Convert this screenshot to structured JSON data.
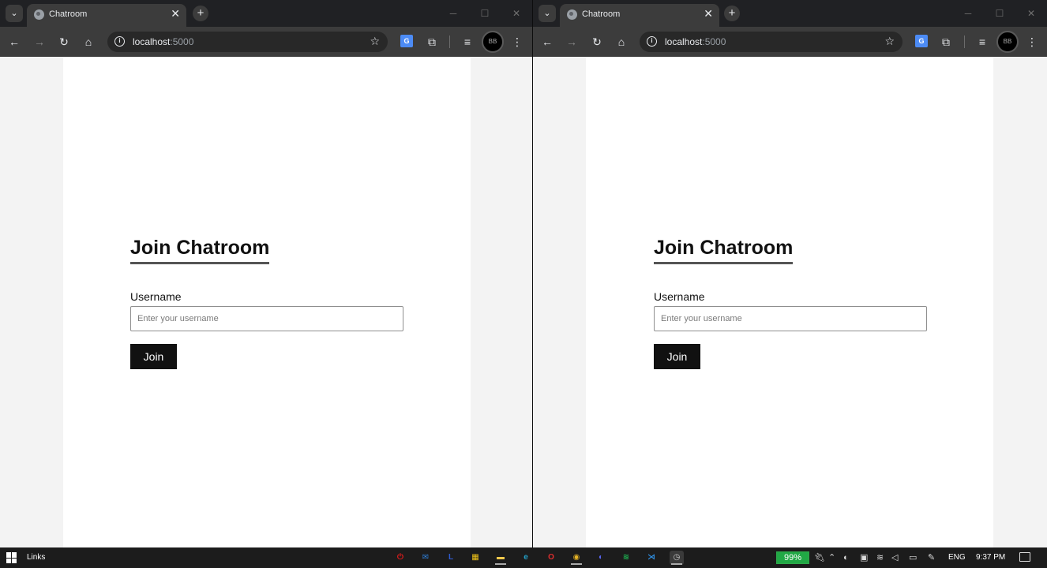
{
  "browser": {
    "tab_title": "Chatroom",
    "url_host": "localhost",
    "url_port": ":5000",
    "icons": [
      "tab-search-icon",
      "favicon-globe-icon",
      "close-icon",
      "new-tab-icon",
      "minimize-icon",
      "maximize-icon",
      "window-close-icon",
      "back-icon",
      "forward-icon",
      "reload-icon",
      "home-icon",
      "site-info-icon",
      "bookmark-star-icon",
      "translate-icon",
      "extensions-icon",
      "media-control-icon",
      "profile-avatar",
      "kebab-menu-icon"
    ]
  },
  "glyphs": {
    "tab_search": "⌄",
    "tab_close": "✕",
    "new_tab": "+",
    "minimize": "─",
    "maximize": "☐",
    "window_close": "✕",
    "back": "←",
    "forward": "→",
    "reload": "↻",
    "home": "⌂",
    "info": "i",
    "star": "☆",
    "translate": "G",
    "extensions": "⧉",
    "media": "≡",
    "profile": "BB",
    "menu": "⋮"
  },
  "app": {
    "heading": "Join Chatroom",
    "username_label": "Username",
    "username_placeholder": "Enter your username",
    "join_label": "Join"
  },
  "taskbar": {
    "links_label": "Links",
    "battery": "99%",
    "language": "ENG",
    "time": "9:37 PM",
    "apps": [
      {
        "name": "power-app-icon",
        "glyph": "⏻",
        "color": "#e21b1b"
      },
      {
        "name": "mail-app-icon",
        "glyph": "✉",
        "color": "#2f7fd8"
      },
      {
        "name": "l-app-icon",
        "glyph": "L",
        "color": "#2f5bd0"
      },
      {
        "name": "calendar-app-icon",
        "glyph": "▦",
        "color": "#f0c419"
      },
      {
        "name": "file-explorer-icon",
        "glyph": "▬",
        "color": "#f2c94c"
      },
      {
        "name": "edge-icon",
        "glyph": "e",
        "color": "#22a0c8"
      },
      {
        "name": "opera-icon",
        "glyph": "O",
        "color": "#e02e2e"
      },
      {
        "name": "chrome-icon",
        "glyph": "◉",
        "color": "#e6b325"
      },
      {
        "name": "discord-icon",
        "glyph": "◐",
        "color": "#5865f2"
      },
      {
        "name": "spotify-icon",
        "glyph": "≋",
        "color": "#1db954"
      },
      {
        "name": "vscode-icon",
        "glyph": "⋊",
        "color": "#2f8ee0"
      },
      {
        "name": "clock-app-icon",
        "glyph": "◷",
        "color": "#cccccc"
      }
    ]
  }
}
